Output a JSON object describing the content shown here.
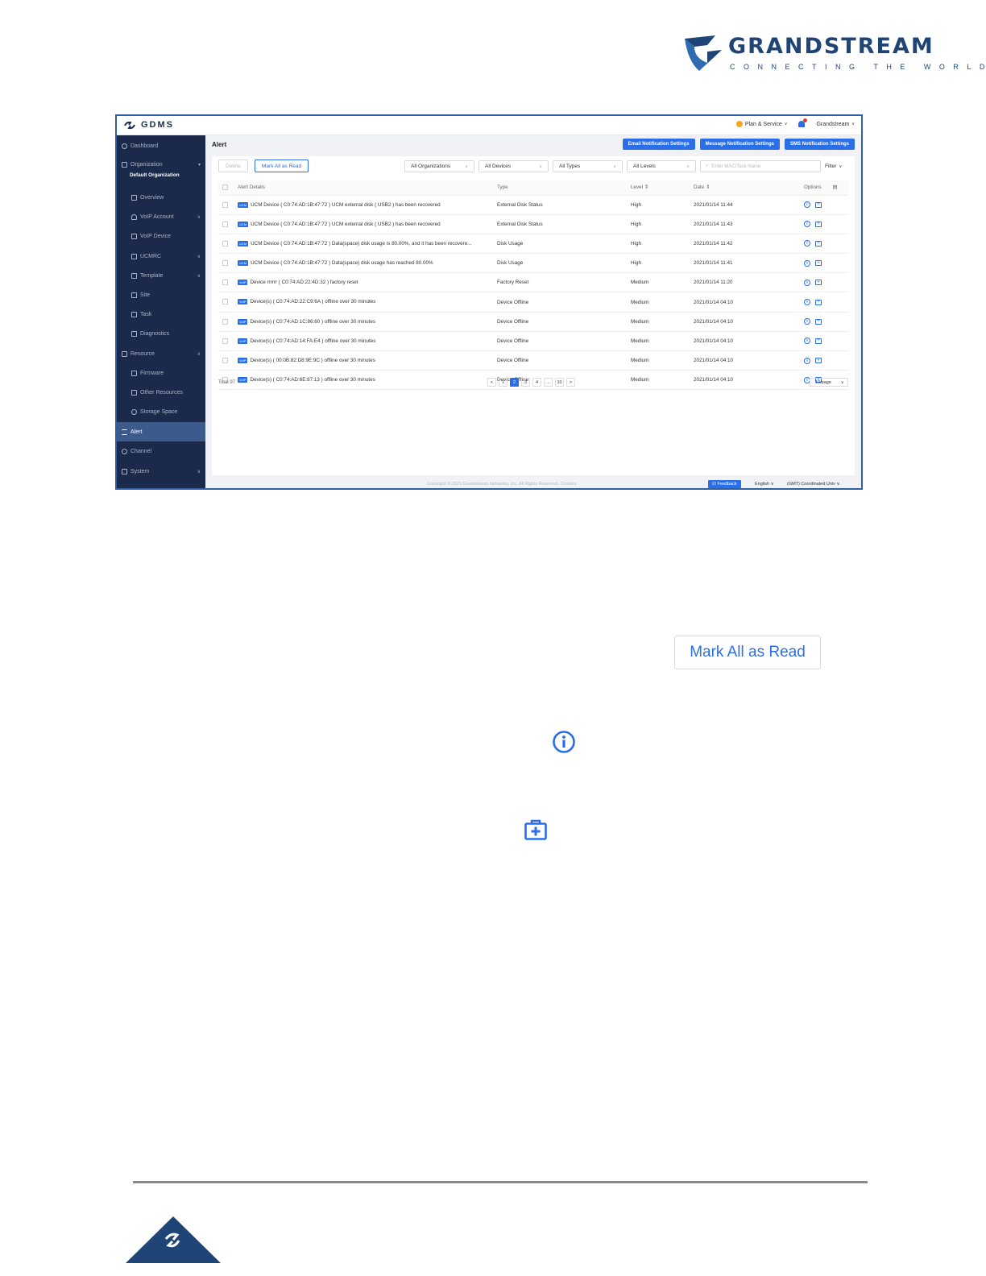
{
  "brand": {
    "name": "GRANDSTREAM",
    "tagline": "CONNECTING THE WORLD"
  },
  "app": {
    "name": "GDMS",
    "plan": "Plan & Service",
    "user": "Grandstream"
  },
  "sidebar": {
    "items": [
      {
        "label": "Dashboard"
      },
      {
        "label": "Organization"
      },
      {
        "label": "Default Organization"
      },
      {
        "label": "Overview"
      },
      {
        "label": "VoIP Account"
      },
      {
        "label": "VoIP Device"
      },
      {
        "label": "UCMRC"
      },
      {
        "label": "Template"
      },
      {
        "label": "Site"
      },
      {
        "label": "Task"
      },
      {
        "label": "Diagnostics"
      },
      {
        "label": "Resource"
      },
      {
        "label": "Firmware"
      },
      {
        "label": "Other Resources"
      },
      {
        "label": "Storage Space"
      },
      {
        "label": "Alert"
      },
      {
        "label": "Channel"
      },
      {
        "label": "System"
      }
    ]
  },
  "page": {
    "title": "Alert",
    "btn_email": "Email Notification Settings",
    "btn_message": "Message Notification Settings",
    "btn_sms": "SMS Notification Settings"
  },
  "toolbar": {
    "delete": "Delete",
    "mark_all": "Mark All as Read",
    "org": "All Organizations",
    "devices": "All Devices",
    "types": "All Types",
    "levels": "All Levels",
    "search_placeholder": "Enter MAC/Task Name",
    "filter": "Filter"
  },
  "table": {
    "headers": {
      "details": "Alert Details",
      "type": "Type",
      "level": "Level",
      "date": "Date",
      "options": "Options"
    },
    "rows": [
      {
        "tag": "UCM",
        "details": "UCM Device ( C0:74:AD:1B:47:72 ) UCM external disk ( USB2 ) has been recovered",
        "type": "External Disk Status",
        "level": "High",
        "date": "2021/01/14 11:44"
      },
      {
        "tag": "UCM",
        "details": "UCM Device ( C0:74:AD:1B:47:72 ) UCM external disk ( USB2 ) has been recovered",
        "type": "External Disk Status",
        "level": "High",
        "date": "2021/01/14 11:43"
      },
      {
        "tag": "UCM",
        "details": "UCM Device ( C0:74:AD:1B:47:72 ) Data(space) disk usage is 80.00%, and it has been recovere...",
        "type": "Disk Usage",
        "level": "High",
        "date": "2021/01/14 11:42"
      },
      {
        "tag": "UCM",
        "details": "UCM Device ( C0:74:AD:1B:47:72 ) Data(space) disk usage has reached 80.00%",
        "type": "Disk Usage",
        "level": "High",
        "date": "2021/01/14 11:41"
      },
      {
        "tag": "VoIP",
        "details": "Device rrrrrr ( C0:74:AD:22:4D:32 ) factory reset",
        "type": "Factory Reset",
        "level": "Medium",
        "date": "2021/01/14 11:20"
      },
      {
        "tag": "VoIP",
        "details": "Device(s) ( C0:74:AD:22:C9:6A ) offline over 30 minutes",
        "type": "Device Offline",
        "level": "Medium",
        "date": "2021/01/14 04:10"
      },
      {
        "tag": "VoIP",
        "details": "Device(s) ( C0:74:AD:1C:86:60 ) offline over 30 minutes",
        "type": "Device Offline",
        "level": "Medium",
        "date": "2021/01/14 04:10"
      },
      {
        "tag": "VoIP",
        "details": "Device(s) ( C0:74:AD:14:FA:E4 ) offline over 30 minutes",
        "type": "Device Offline",
        "level": "Medium",
        "date": "2021/01/14 04:10"
      },
      {
        "tag": "VoIP",
        "details": "Device(s) ( 00:0B:82:D8:9E:9C ) offline over 30 minutes",
        "type": "Device Offline",
        "level": "Medium",
        "date": "2021/01/14 04:10"
      },
      {
        "tag": "VoIP",
        "details": "Device(s) ( C0:74:AD:6E:87:13 ) offline over 30 minutes",
        "type": "Device Offline",
        "level": "Medium",
        "date": "2021/01/14 04:10"
      }
    ]
  },
  "pager": {
    "total": "Total 97",
    "pages": [
      "<",
      "1",
      "2",
      "3",
      "4",
      "...",
      "10",
      ">"
    ],
    "per_page": "10/page"
  },
  "footer": {
    "copyright": "Copyright © 2021 Grandstream Networks, Inc. All Rights Reserved.   Cookies",
    "feedback": "Feedback",
    "language": "English",
    "timezone": "(GMT) Coordinated Univ"
  },
  "callout": {
    "mark_all": "Mark All as Read"
  },
  "colors": {
    "accent": "#2a6ee8",
    "sidebar": "#1b2a4a",
    "brand": "#1f4476"
  }
}
